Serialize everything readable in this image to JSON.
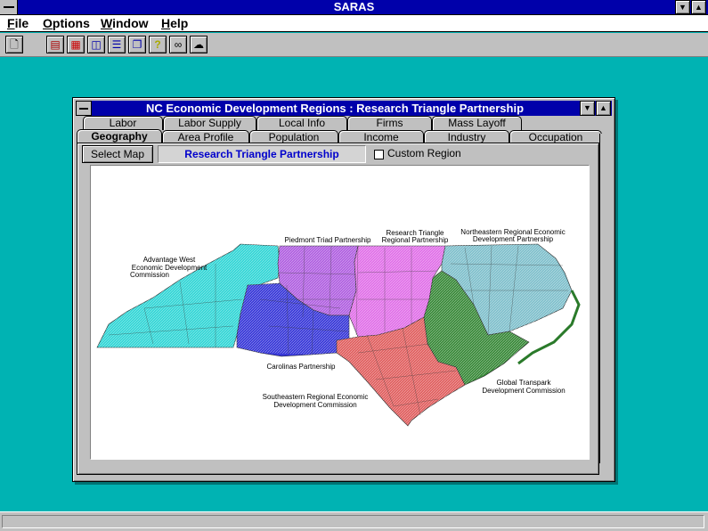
{
  "app": {
    "title": "SARAS"
  },
  "menu": [
    {
      "prefix": "",
      "ul": "F",
      "rest": "ile"
    },
    {
      "prefix": "",
      "ul": "O",
      "rest": "ptions"
    },
    {
      "prefix": "",
      "ul": "W",
      "rest": "indow"
    },
    {
      "prefix": "",
      "ul": "H",
      "rest": "elp"
    }
  ],
  "toolbar": [
    {
      "icon": "new-document-icon",
      "glyph": "🗋"
    },
    {
      "icon": "report-icon",
      "glyph": "▤"
    },
    {
      "icon": "chart-icon",
      "glyph": "▦"
    },
    {
      "icon": "tile-window-icon",
      "glyph": "◫"
    },
    {
      "icon": "layout-icon",
      "glyph": "☰"
    },
    {
      "icon": "cascade-window-icon",
      "glyph": "❐"
    },
    {
      "icon": "help-icon",
      "glyph": "?"
    },
    {
      "icon": "find-binoculars-icon",
      "glyph": "∞"
    },
    {
      "icon": "draw-region-icon",
      "glyph": "☁"
    }
  ],
  "child_window": {
    "title": "NC Economic Development Regions : Research Triangle Partnership",
    "tabs_back": [
      "Labor",
      "Labor Supply",
      "Local Info",
      "Firms",
      "Mass Layoff"
    ],
    "tabs_front": [
      "Geography",
      "Area Profile",
      "Population",
      "Income",
      "Industry",
      "Occupation"
    ],
    "active_tab": "Geography",
    "select_map_label": "Select Map",
    "region_name": "Research Triangle Partnership",
    "custom_region_label": "Custom Region",
    "custom_region_checked": false
  },
  "map": {
    "labels": {
      "advantage_west": [
        "Advantage West",
        "Economic Development",
        "Commission"
      ],
      "piedmont": [
        "Piedmont Triad Partnership"
      ],
      "research_triangle": [
        "Research Triangle",
        "Regional Partnership"
      ],
      "northeastern": [
        "Northeastern Regional Economic",
        "Development Partnership"
      ],
      "carolinas": [
        "Carolinas Partnership"
      ],
      "southeastern": [
        "Southeastern Regional Economic",
        "Development Commission"
      ],
      "global_transpark": [
        "Global Transpark",
        "Development Commission"
      ]
    },
    "colors": {
      "advantage_west": "#33d6d6",
      "piedmont": "#b060e0",
      "research_triangle": "#e070e8",
      "northeastern": "#80c0cc",
      "carolinas": "#3838d8",
      "southeastern": "#e06060",
      "global_transpark": "#3a8a3a"
    }
  }
}
